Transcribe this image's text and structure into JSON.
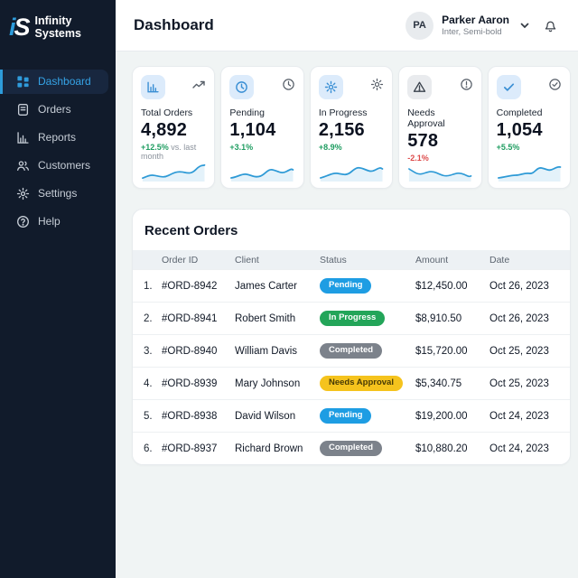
{
  "brand": {
    "logo_i": "i",
    "logo_s": "S",
    "name_line1": "Infinity",
    "name_line2": "Systems"
  },
  "sidebar": {
    "items": [
      {
        "label": "Dashboard",
        "icon": "grid-icon",
        "active": true
      },
      {
        "label": "Orders",
        "icon": "document-icon",
        "active": false
      },
      {
        "label": "Reports",
        "icon": "bar-chart-icon",
        "active": false
      },
      {
        "label": "Customers",
        "icon": "users-icon",
        "active": false
      },
      {
        "label": "Settings",
        "icon": "gear-icon",
        "active": false
      },
      {
        "label": "Help",
        "icon": "help-circle-icon",
        "active": false
      }
    ]
  },
  "header": {
    "title": "Dashboard",
    "user": {
      "initials": "PA",
      "name": "Parker Aaron",
      "subtitle": "Inter, Semi-bold"
    }
  },
  "stats": [
    {
      "label": "Total Orders",
      "value": "4,892",
      "delta": "+12.5%",
      "delta_suffix": " vs. last month",
      "trend": "up",
      "icon": "bar-chart-icon",
      "corner_icon": "trend-up-icon"
    },
    {
      "label": "Pending",
      "value": "1,104",
      "delta": "+3.1%",
      "delta_suffix": "",
      "trend": "up",
      "icon": "clock-icon",
      "corner_icon": "clock-icon"
    },
    {
      "label": "In Progress",
      "value": "2,156",
      "delta": "+8.9%",
      "delta_suffix": "",
      "trend": "up",
      "icon": "gear-icon",
      "corner_icon": "gear-icon"
    },
    {
      "label": "Needs Approval",
      "value": "578",
      "delta": "-2.1%",
      "delta_suffix": "",
      "trend": "down",
      "icon": "warning-triangle-icon",
      "corner_icon": "alert-circle-icon"
    },
    {
      "label": "Completed",
      "value": "1,054",
      "delta": "+5.5%",
      "delta_suffix": "",
      "trend": "up",
      "icon": "check-icon",
      "corner_icon": "check-circle-icon"
    }
  ],
  "orders": {
    "title": "Recent Orders",
    "columns": {
      "id": "Order ID",
      "client": "Client",
      "status": "Status",
      "amount": "Amount",
      "date": "Date"
    },
    "rows": [
      {
        "index": "1.",
        "id": "#ORD-8942",
        "client": "James Carter",
        "status": "Pending",
        "amount": "$12,450.00",
        "date": "Oct 26, 2023"
      },
      {
        "index": "2.",
        "id": "#ORD-8941",
        "client": "Robert Smith",
        "status": "In Progress",
        "amount": "$8,910.50",
        "date": "Oct 26, 2023"
      },
      {
        "index": "3.",
        "id": "#ORD-8940",
        "client": "William Davis",
        "status": "Completed",
        "amount": "$15,720.00",
        "date": "Oct 25, 2023"
      },
      {
        "index": "4.",
        "id": "#ORD-8939",
        "client": "Mary Johnson",
        "status": "Needs Approval",
        "amount": "$5,340.75",
        "date": "Oct 25, 2023"
      },
      {
        "index": "5.",
        "id": "#ORD-8938",
        "client": "David Wilson",
        "status": "Pending",
        "amount": "$19,200.00",
        "date": "Oct 24, 2023"
      },
      {
        "index": "6.",
        "id": "#ORD-8937",
        "client": "Richard Brown",
        "status": "Completed",
        "amount": "$10,880.20",
        "date": "Oct 24, 2023"
      }
    ]
  },
  "colors": {
    "sidebar_bg": "#111b2b",
    "accent_blue": "#2d9cdb",
    "badge_pending": "#1e9de3",
    "badge_in_progress": "#23a559",
    "badge_completed": "#7c828b",
    "badge_needs_approval": "#f5c31d",
    "delta_up": "#1f9d61",
    "delta_down": "#dd4b4b",
    "spark_line": "#2e9ad6",
    "main_bg": "#f0f4f4"
  }
}
